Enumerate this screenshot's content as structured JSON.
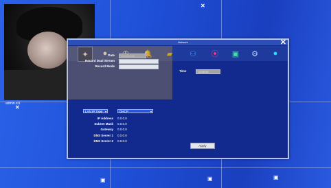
{
  "camera": {
    "label": "admin.xt1"
  },
  "dialog": {
    "title": "Network",
    "tools": [
      {
        "name": "wizard-icon",
        "glyph": "✦",
        "color": "#ffffff"
      },
      {
        "name": "camera-icon",
        "glyph": "●",
        "color": "#ffffff"
      },
      {
        "name": "reel-icon",
        "glyph": "✇",
        "color": "#ffffff"
      },
      {
        "name": "bell-icon",
        "glyph": "🔔",
        "color": "#ffd21a"
      },
      {
        "name": "folder-icon",
        "glyph": "▰",
        "color": "#f0c420"
      },
      {
        "name": "network-icon",
        "glyph": "⚇",
        "color": "#3aa0ff"
      },
      {
        "name": "search-icon",
        "glyph": "⦿",
        "color": "#ff3b8a"
      },
      {
        "name": "monitor-icon",
        "glyph": "▣",
        "color": "#3fe0a0"
      },
      {
        "name": "gears-icon",
        "glyph": "⚙",
        "color": "#bcd0ff"
      },
      {
        "name": "info-icon",
        "glyph": "●",
        "color": "#29e0ff"
      }
    ],
    "date": {
      "label": "Date",
      "value": "2016/02/26"
    },
    "time": {
      "label": "Time",
      "value": "13:56:56"
    },
    "record_dual_stream": {
      "label": "Record Dual Stream"
    },
    "record_mode": {
      "label": "Record Mode"
    },
    "lan_type": {
      "value": "LAN IP Type",
      "mode": "DHCP"
    },
    "network": [
      {
        "label": "IP Address",
        "value": "0.0.0.0"
      },
      {
        "label": "Subnet Mask",
        "value": "0.0.0.0"
      },
      {
        "label": "Gateway",
        "value": "0.0.0.0"
      },
      {
        "label": "DNS Server 1",
        "value": "0.0.0.0"
      },
      {
        "label": "DNS Server 2",
        "value": "0.0.0.0"
      }
    ],
    "apply_label": "Apply"
  }
}
